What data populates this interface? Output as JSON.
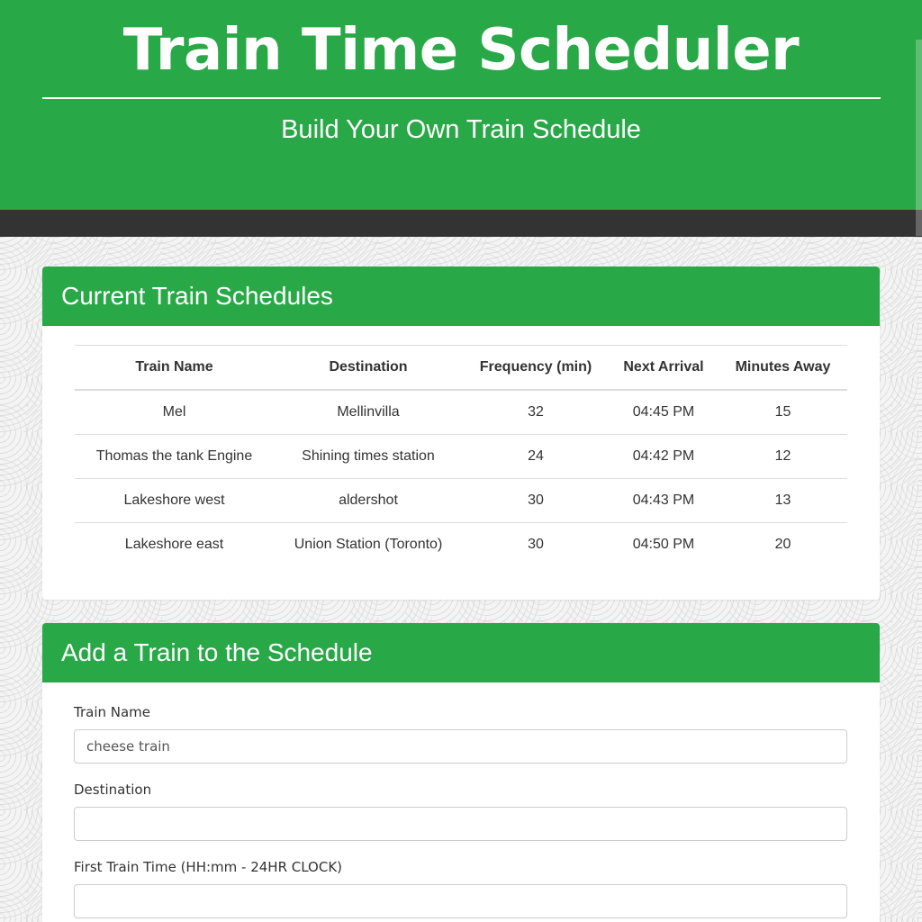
{
  "header": {
    "title": "Train Time Scheduler",
    "subtitle": "Build Your Own Train Schedule"
  },
  "schedules": {
    "heading": "Current Train Schedules",
    "columns": [
      "Train Name",
      "Destination",
      "Frequency (min)",
      "Next Arrival",
      "Minutes Away"
    ],
    "rows": [
      [
        "Mel",
        "Mellinvilla",
        "32",
        "04:45 PM",
        "15"
      ],
      [
        "Thomas the tank Engine",
        "Shining times station",
        "24",
        "04:42 PM",
        "12"
      ],
      [
        "Lakeshore west",
        "aldershot",
        "30",
        "04:43 PM",
        "13"
      ],
      [
        "Lakeshore east",
        "Union Station (Toronto)",
        "30",
        "04:50 PM",
        "20"
      ]
    ]
  },
  "add_train": {
    "heading": "Add a Train to the Schedule",
    "train_name_label": "Train Name",
    "train_name_value": "cheese train",
    "destination_label": "Destination",
    "destination_value": "",
    "first_time_label": "First Train Time (HH:mm - 24HR CLOCK)",
    "first_time_value": ""
  },
  "colors": {
    "brand_green": "#29a847",
    "dark_bar": "#333333"
  }
}
